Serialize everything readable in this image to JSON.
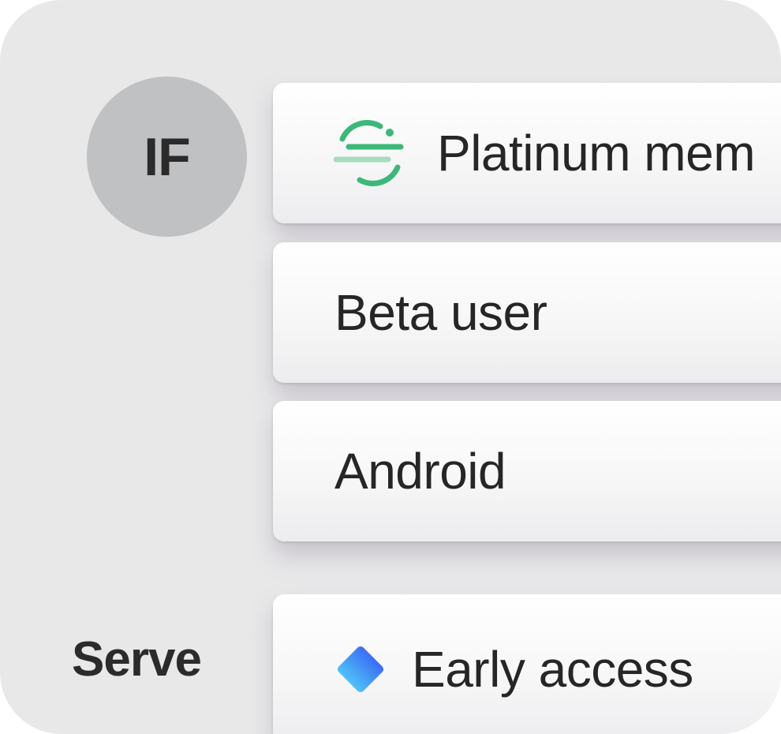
{
  "avatar": {
    "initials": "IF"
  },
  "serve": {
    "label": "Serve"
  },
  "segments": [
    {
      "label": "Platinum mem",
      "icon": "segment-icon"
    },
    {
      "label": "Beta user"
    },
    {
      "label": "Android"
    }
  ],
  "variation": {
    "label": "Early access",
    "icon": "diamond-icon"
  },
  "colors": {
    "segment_icon": "#3cb878",
    "diamond_top": "#3b6cf6",
    "diamond_bottom": "#4fc3f7"
  }
}
